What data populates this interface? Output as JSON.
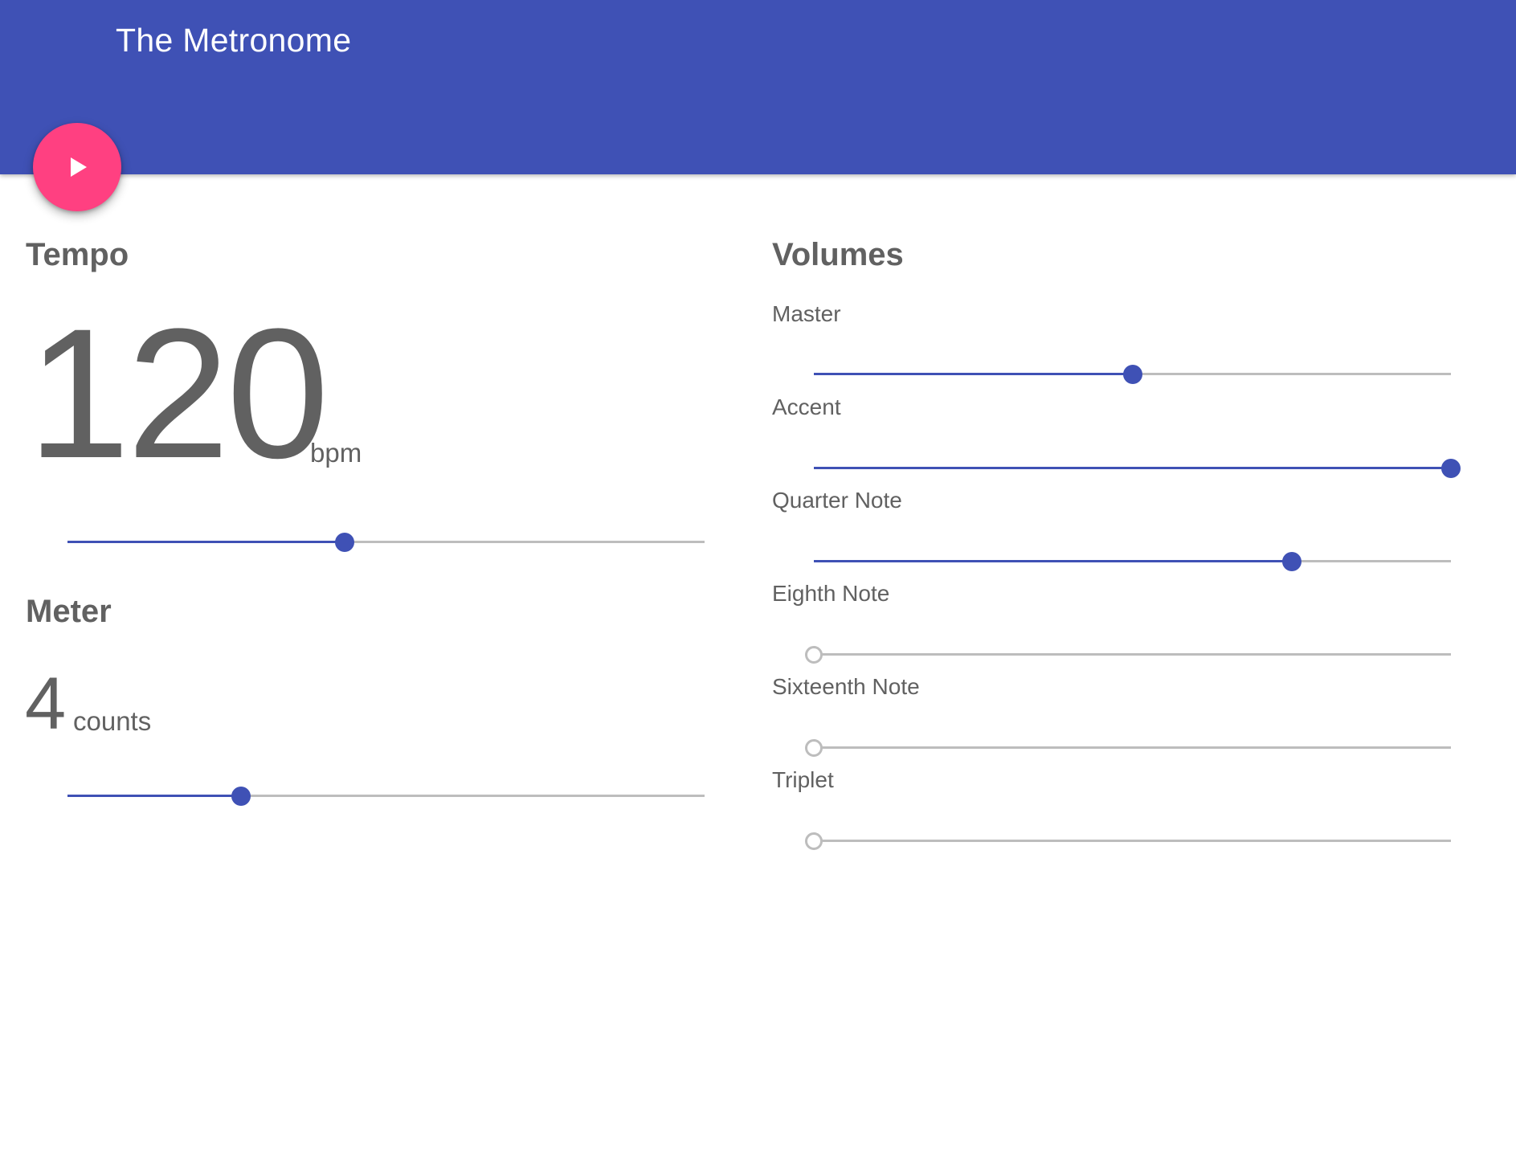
{
  "app": {
    "title": "The Metronome",
    "primary_color": "#3f51b5",
    "accent_color": "#ff4081"
  },
  "fab": {
    "icon": "play-icon"
  },
  "tempo": {
    "heading": "Tempo",
    "value": "120",
    "unit": "bpm",
    "slider_fraction": 0.435
  },
  "meter": {
    "heading": "Meter",
    "value": "4",
    "unit": "counts",
    "slider_fraction": 0.273
  },
  "volumes": {
    "heading": "Volumes",
    "items": [
      {
        "label": "Master",
        "fraction": 0.5
      },
      {
        "label": "Accent",
        "fraction": 1.0
      },
      {
        "label": "Quarter Note",
        "fraction": 0.75
      },
      {
        "label": "Eighth Note",
        "fraction": 0.0
      },
      {
        "label": "Sixteenth Note",
        "fraction": 0.0
      },
      {
        "label": "Triplet",
        "fraction": 0.0
      }
    ]
  }
}
